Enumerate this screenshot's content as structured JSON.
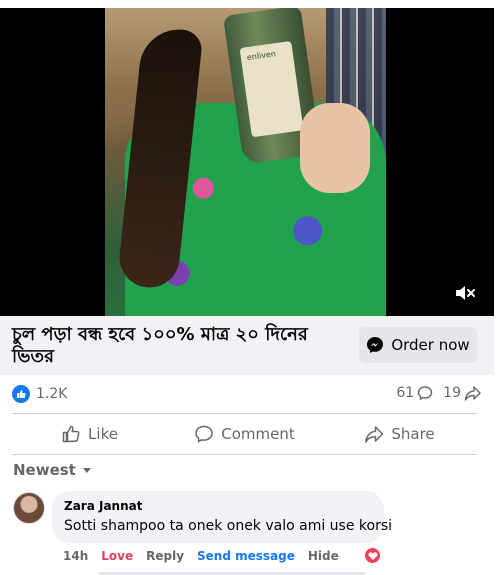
{
  "post": {
    "title": "চুল পড়া বন্ধ হবে ১০০% মাত্র ২০ দিনের ভিতর",
    "order_label": "Order now",
    "bottle_brand": "enliven"
  },
  "stats": {
    "likes": "1.2K",
    "comments": "61",
    "shares": "19"
  },
  "actions": {
    "like": "Like",
    "comment": "Comment",
    "share": "Share"
  },
  "comments_sort": "Newest",
  "comment": {
    "author": "Zara Jannat",
    "text": "Sotti shampoo ta onek onek valo ami use korsi",
    "time": "14h",
    "reaction_label": "Love",
    "reply_label": "Reply",
    "send_message_label": "Send message",
    "hide_label": "Hide"
  },
  "colors": {
    "accent": "#1877f2",
    "love": "#f33e58",
    "muted_text": "#65676b",
    "surface": "#f0f2f5"
  },
  "icons": [
    "mute-icon",
    "messenger-icon",
    "like-badge-icon",
    "comment-count-icon",
    "share-count-icon",
    "like-icon",
    "comment-icon",
    "share-icon",
    "chevron-down-icon",
    "love-reaction-icon"
  ]
}
